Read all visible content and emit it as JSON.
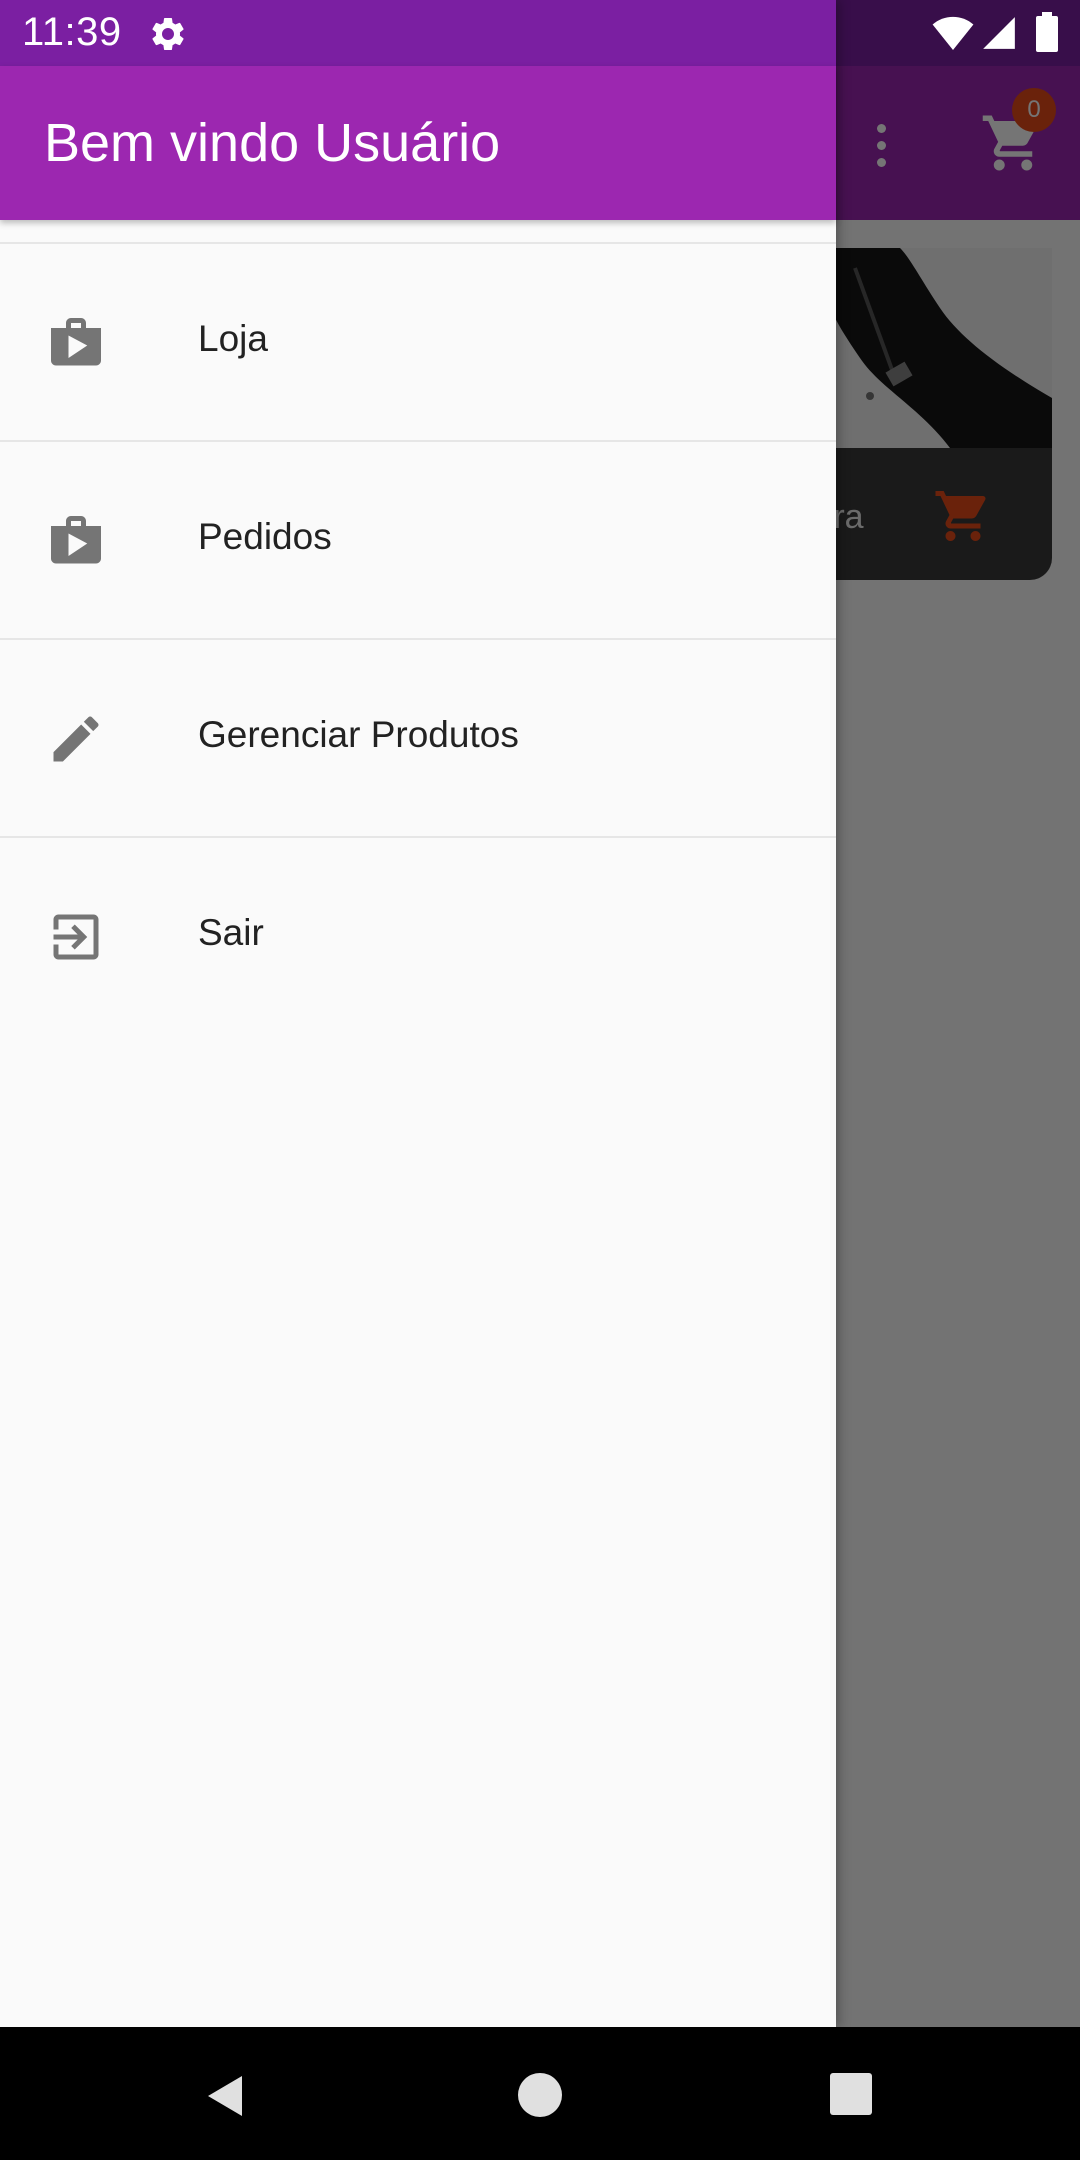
{
  "status_bar": {
    "time": "11:39",
    "icons": [
      "gear-icon",
      "wifi-icon",
      "signal-icon",
      "battery-icon"
    ]
  },
  "app_bar": {
    "cart_count": "0"
  },
  "product": {
    "label_partial": "rra"
  },
  "drawer": {
    "title": "Bem vindo Usuário",
    "items": [
      {
        "label": "Loja",
        "icon": "shop-bag-icon"
      },
      {
        "label": "Pedidos",
        "icon": "shop-bag-icon"
      },
      {
        "label": "Gerenciar Produtos",
        "icon": "pencil-icon"
      },
      {
        "label": "Sair",
        "icon": "exit-icon"
      }
    ]
  },
  "colors": {
    "primary": "#9c27b0",
    "primary_dark": "#7b1fa2",
    "accent": "#e64a19",
    "icon_gray": "#757575"
  }
}
